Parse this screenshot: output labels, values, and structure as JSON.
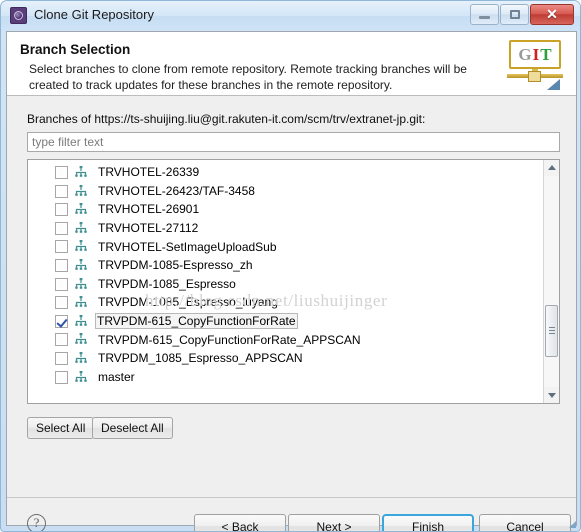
{
  "window": {
    "title": "Clone Git Repository",
    "app_icon": "gear-icon",
    "controls": {
      "minimize": "minimize-icon",
      "maximize": "restore-icon",
      "close": "✕"
    }
  },
  "header": {
    "title": "Branch Selection",
    "description": "Select branches to clone from remote repository. Remote tracking branches will be created to track updates for these branches in the remote repository.",
    "logo": {
      "g": "G",
      "i": "I",
      "t": "T"
    }
  },
  "body": {
    "branches_label": "Branches of https://ts-shuijing.liu@git.rakuten-it.com/scm/trv/extranet-jp.git:",
    "filter": {
      "value": "",
      "placeholder": "type filter text"
    },
    "branches": [
      {
        "label": "TRVHOTEL-26339",
        "checked": false,
        "selected": false
      },
      {
        "label": "TRVHOTEL-26423/TAF-3458",
        "checked": false,
        "selected": false
      },
      {
        "label": "TRVHOTEL-26901",
        "checked": false,
        "selected": false
      },
      {
        "label": "TRVHOTEL-27112",
        "checked": false,
        "selected": false
      },
      {
        "label": "TRVHOTEL-SetImageUploadSub",
        "checked": false,
        "selected": false
      },
      {
        "label": "TRVPDM-1085-Espresso_zh",
        "checked": false,
        "selected": false
      },
      {
        "label": "TRVPDM-1085_Espresso",
        "checked": false,
        "selected": false
      },
      {
        "label": "TRVPDM-1085_Espresso_luyang",
        "checked": false,
        "selected": false
      },
      {
        "label": "TRVPDM-615_CopyFunctionForRate",
        "checked": true,
        "selected": true
      },
      {
        "label": "TRVPDM-615_CopyFunctionForRate_APPSCAN",
        "checked": false,
        "selected": false
      },
      {
        "label": "TRVPDM_1085_Espresso_APPSCAN",
        "checked": false,
        "selected": false
      },
      {
        "label": "master",
        "checked": false,
        "selected": false
      }
    ],
    "select_all_label": "Select All",
    "deselect_all_label": "Deselect All",
    "watermark": "http://blog.csdn.net/liushuijinger"
  },
  "footer": {
    "help": "?",
    "back_label": "< Back",
    "next_label": "Next >",
    "finish_label": "Finish",
    "cancel_label": "Cancel"
  },
  "colors": {
    "titlebar": "#d3e5f5",
    "dialog_bg": "#efefef",
    "focus_border": "#3ba6dd",
    "close_button": "#c9463b",
    "branch_icon": "#3f8f8f",
    "check_mark": "#2f53a8"
  }
}
